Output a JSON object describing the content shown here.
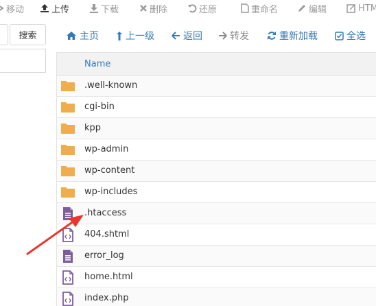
{
  "toolbar": {
    "items": [
      {
        "label": "移动",
        "icon": "move-icon",
        "active": false
      },
      {
        "label": "上传",
        "icon": "upload-icon",
        "active": true
      },
      {
        "label": "下载",
        "icon": "download-icon",
        "active": false
      },
      {
        "label": "删除",
        "icon": "delete-icon",
        "active": false
      },
      {
        "label": "还原",
        "icon": "restore-icon",
        "active": false
      },
      {
        "label": "重命名",
        "icon": "rename-icon",
        "active": false
      },
      {
        "label": "编辑",
        "icon": "edit-icon",
        "active": false
      },
      {
        "label": "HTM",
        "icon": "html-editor-icon",
        "active": false
      }
    ]
  },
  "search": {
    "button_label": "搜索"
  },
  "nav": {
    "home": "主页",
    "up": "上一级",
    "back": "返回",
    "forward": "转发",
    "reload": "重新加载",
    "select_all": "全选"
  },
  "table": {
    "header_name": "Name",
    "rows": [
      {
        "name": ".well-known",
        "type": "folder"
      },
      {
        "name": "cgi-bin",
        "type": "folder"
      },
      {
        "name": "kpp",
        "type": "folder"
      },
      {
        "name": "wp-admin",
        "type": "folder"
      },
      {
        "name": "wp-content",
        "type": "folder"
      },
      {
        "name": "wp-includes",
        "type": "folder"
      },
      {
        "name": ".htaccess",
        "type": "text-file"
      },
      {
        "name": "404.shtml",
        "type": "code-file"
      },
      {
        "name": "error_log",
        "type": "text-file"
      },
      {
        "name": "home.html",
        "type": "code-file"
      },
      {
        "name": "index.php",
        "type": "code-file"
      }
    ]
  },
  "colors": {
    "link": "#337ab7",
    "folder": "#f0ad4e",
    "file": "#7d5d9c",
    "annotation_arrow": "#e8382c"
  }
}
